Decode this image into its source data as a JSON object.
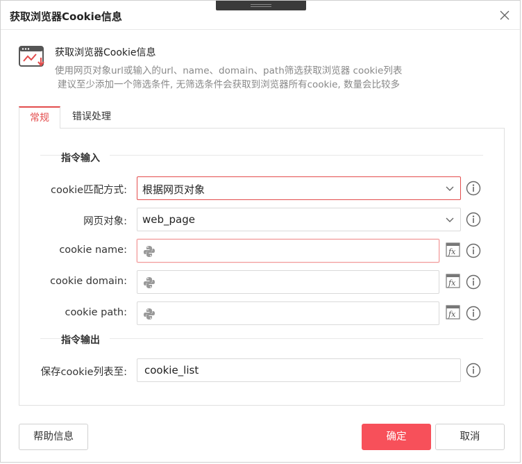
{
  "dialog": {
    "title": "获取浏览器Cookie信息"
  },
  "header": {
    "icon": "browser-chart-download-icon",
    "title": "获取浏览器Cookie信息",
    "description_line1": "使用网页对象url或输入的url、name、domain、path筛选获取浏览器 cookie列表",
    "description_line2": "建议至少添加一个筛选条件, 无筛选条件会获取到浏览器所有cookie, 数量会比较多"
  },
  "tabs": [
    {
      "label": "常规",
      "active": true
    },
    {
      "label": "错误处理",
      "active": false
    }
  ],
  "input_section": {
    "title": "指令输入",
    "rows": [
      {
        "label": "cookie匹配方式:",
        "type": "select",
        "value": "根据网页对象"
      },
      {
        "label": "网页对象:",
        "type": "select",
        "value": "web_page"
      },
      {
        "label": "cookie name:",
        "type": "python-input",
        "value": ""
      },
      {
        "label": "cookie domain:",
        "type": "python-input",
        "value": ""
      },
      {
        "label": "cookie path:",
        "type": "python-input",
        "value": ""
      }
    ]
  },
  "output_section": {
    "title": "指令输出",
    "rows": [
      {
        "label": "保存cookie列表至:",
        "type": "text",
        "value": "cookie_list"
      }
    ]
  },
  "buttons": {
    "help": "帮助信息",
    "confirm": "确定",
    "cancel": "取消"
  },
  "colors": {
    "accent": "#e34c4c",
    "primary_button": "#f7505a"
  }
}
